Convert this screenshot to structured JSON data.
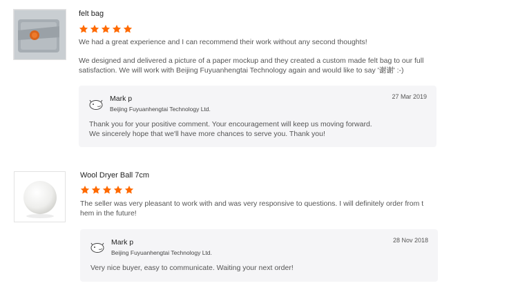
{
  "accent_color": "#ff6a00",
  "reviews": [
    {
      "product_title": "felt bag",
      "rating": 5,
      "text": "We had a great experience and I can recommend their work without any second thoughts!\n\nWe designed and delivered a picture of a paper mockup and they created a custom made felt bag to our full\nsatisfaction. We will work with Beijing Fuyuanhengtai Technology again and would like to say '谢谢' :-)",
      "reply": {
        "seller_name": "Mark p",
        "company": "Beijing Fuyuanhengtai Technology Ltd.",
        "date": "27 Mar 2019",
        "text": "Thank you for your positive comment. Your encouragement will keep us moving forward.\nWe sincerely hope that we'll have more chances to serve you. Thank you!"
      }
    },
    {
      "product_title": "Wool Dryer Ball 7cm",
      "rating": 5,
      "text": "The seller was very pleasant to work with and was very responsive to questions. I will definitely order from t\nhem in the future!",
      "reply": {
        "seller_name": "Mark p",
        "company": "Beijing Fuyuanhengtai Technology Ltd.",
        "date": "28 Nov 2018",
        "text": "Very nice buyer, easy to communicate. Waiting your next order!"
      }
    }
  ]
}
